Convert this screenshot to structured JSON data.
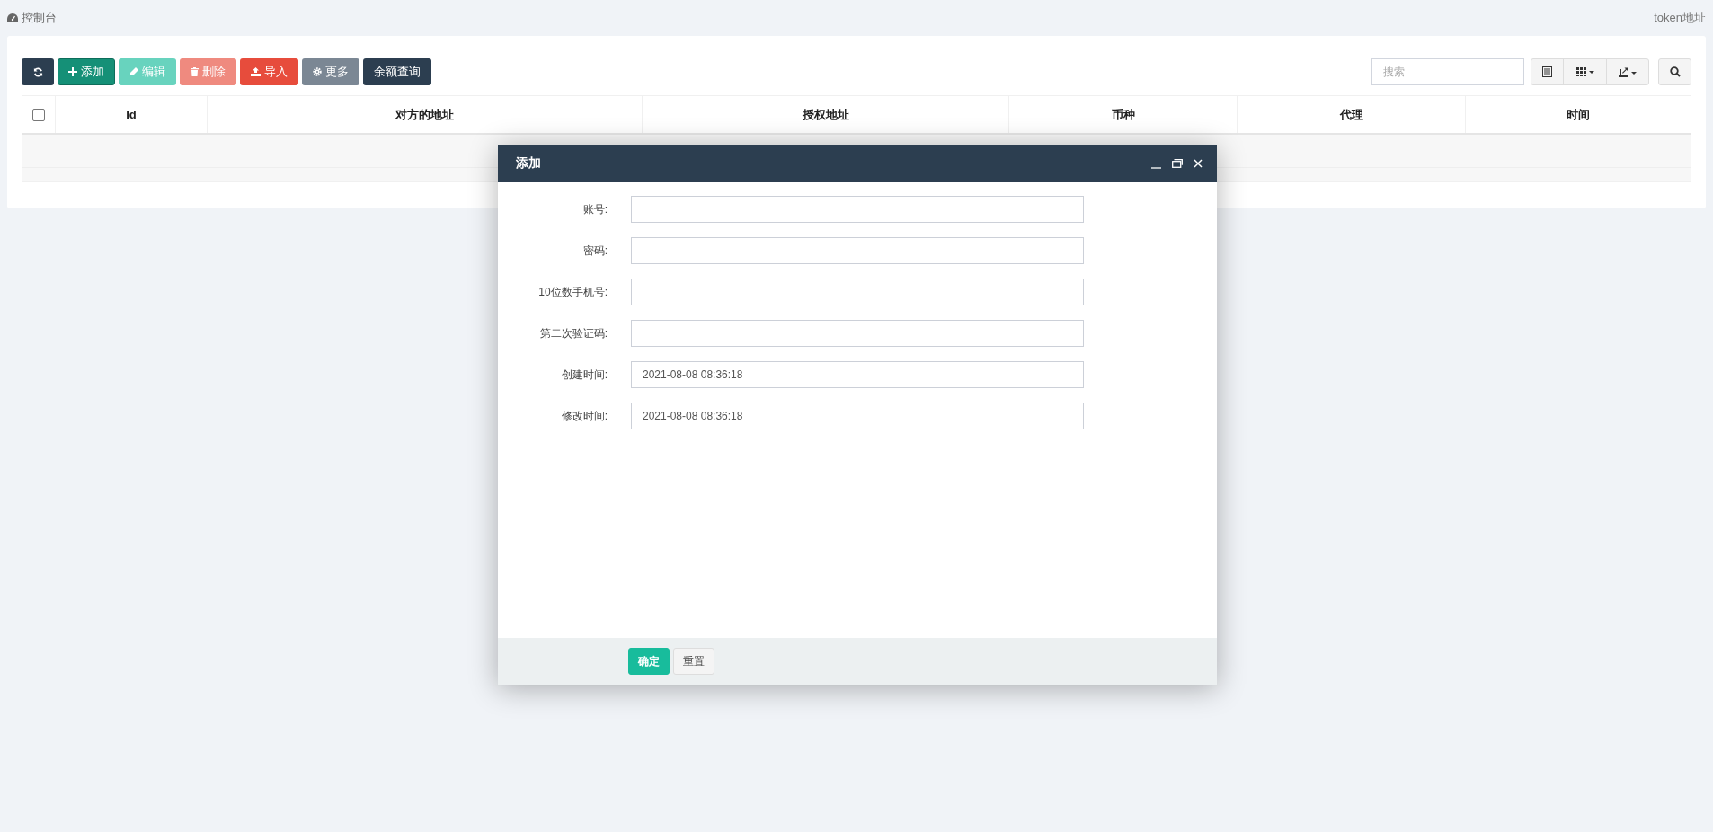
{
  "breadcrumb": {
    "label": "控制台"
  },
  "top_link": "token地址",
  "toolbar": {
    "buttons": [
      {
        "kind": "refresh",
        "disabled": false
      },
      {
        "kind": "add",
        "label": "添加",
        "disabled": false
      },
      {
        "kind": "edit",
        "label": "编辑",
        "disabled": true
      },
      {
        "kind": "delete",
        "label": "删除",
        "disabled": true
      },
      {
        "kind": "import",
        "label": "导入",
        "disabled": false
      },
      {
        "kind": "more",
        "label": "更多",
        "disabled": false
      },
      {
        "kind": "plain",
        "label": "余额查询",
        "disabled": false
      }
    ],
    "search": {
      "placeholder": "搜索"
    },
    "tools": [
      {
        "kind": "list"
      },
      {
        "kind": "columns"
      },
      {
        "kind": "export"
      }
    ]
  },
  "table": {
    "select_all": {
      "checked": false
    },
    "columns": [
      "Id",
      "对方的地址",
      "授权地址",
      "币种",
      "代理",
      "时间"
    ]
  },
  "dialog": {
    "title": "添加",
    "fields": [
      {
        "label": "账号:"
      },
      {
        "label": "密码:"
      },
      {
        "label": "10位数手机号:"
      },
      {
        "label": "第二次验证码:"
      },
      {
        "label": "创建时间:",
        "value": "2021-08-08 08:36:18"
      },
      {
        "label": "修改时间:",
        "value": "2021-08-08 08:36:18"
      }
    ],
    "buttons": [
      {
        "kind": "primary",
        "label": "确定"
      },
      {
        "kind": "default",
        "label": "重置"
      }
    ]
  }
}
